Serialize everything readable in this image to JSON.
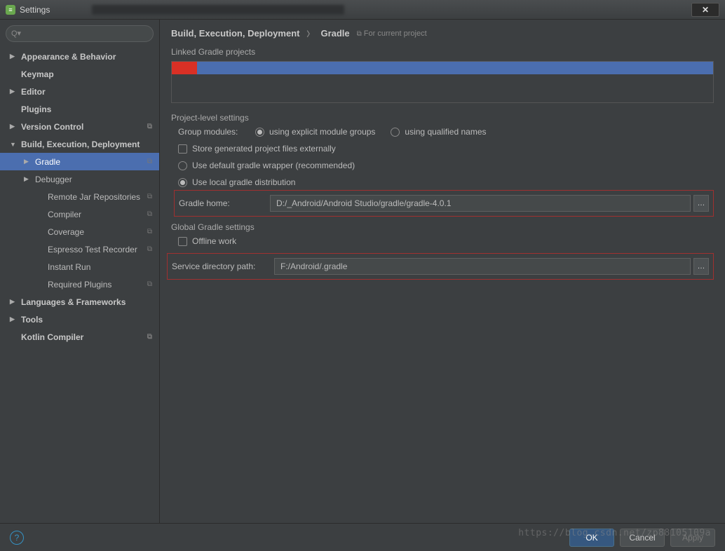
{
  "titlebar": {
    "title": "Settings"
  },
  "sidebar": {
    "items": [
      {
        "label": "Appearance & Behavior",
        "bold": true,
        "arrow": "▶",
        "level": 0
      },
      {
        "label": "Keymap",
        "bold": true,
        "arrow": "",
        "level": 0
      },
      {
        "label": "Editor",
        "bold": true,
        "arrow": "▶",
        "level": 0
      },
      {
        "label": "Plugins",
        "bold": true,
        "arrow": "",
        "level": 0
      },
      {
        "label": "Version Control",
        "bold": true,
        "arrow": "▶",
        "level": 0,
        "copy": true
      },
      {
        "label": "Build, Execution, Deployment",
        "bold": true,
        "arrow": "▼",
        "level": 0
      },
      {
        "label": "Gradle",
        "bold": false,
        "arrow": "▶",
        "level": 1,
        "selected": true,
        "copy": true
      },
      {
        "label": "Debugger",
        "bold": false,
        "arrow": "▶",
        "level": 1
      },
      {
        "label": "Remote Jar Repositories",
        "bold": false,
        "arrow": "",
        "level": 2,
        "copy": true
      },
      {
        "label": "Compiler",
        "bold": false,
        "arrow": "",
        "level": 2,
        "copy": true
      },
      {
        "label": "Coverage",
        "bold": false,
        "arrow": "",
        "level": 2,
        "copy": true
      },
      {
        "label": "Espresso Test Recorder",
        "bold": false,
        "arrow": "",
        "level": 2,
        "copy": true
      },
      {
        "label": "Instant Run",
        "bold": false,
        "arrow": "",
        "level": 2
      },
      {
        "label": "Required Plugins",
        "bold": false,
        "arrow": "",
        "level": 2,
        "copy": true
      },
      {
        "label": "Languages & Frameworks",
        "bold": true,
        "arrow": "▶",
        "level": 0
      },
      {
        "label": "Tools",
        "bold": true,
        "arrow": "▶",
        "level": 0
      },
      {
        "label": "Kotlin Compiler",
        "bold": true,
        "arrow": "",
        "level": 0,
        "copy": true
      }
    ]
  },
  "breadcrumb": {
    "root": "Build, Execution, Deployment",
    "leaf": "Gradle",
    "scope": "For current project"
  },
  "sections": {
    "linked": "Linked Gradle projects",
    "project_level": "Project-level settings",
    "global": "Global Gradle settings"
  },
  "form": {
    "group_modules_label": "Group modules:",
    "opt_explicit_label": "using explicit module groups",
    "opt_qualified_label": "using qualified names",
    "store_external_label": "Store generated project files externally",
    "use_default_wrapper_label": "Use default gradle wrapper (recommended)",
    "use_local_dist_label": "Use local gradle distribution",
    "gradle_home_label": "Gradle home:",
    "gradle_home_value": "D:/_Android/Android Studio/gradle/gradle-4.0.1",
    "offline_work_label": "Offline work",
    "service_dir_label": "Service directory path:",
    "service_dir_value": "F:/Android/.gradle"
  },
  "buttons": {
    "ok": "OK",
    "cancel": "Cancel",
    "apply": "Apply"
  },
  "watermark": "https://blog.csdn.net/zp88105109a"
}
